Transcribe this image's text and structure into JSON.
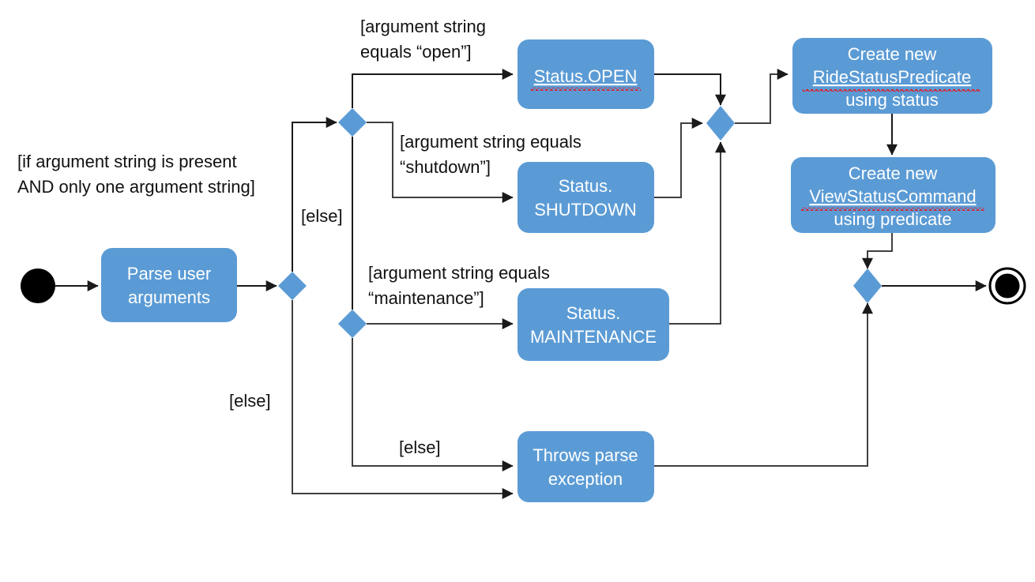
{
  "diagram": {
    "title": "Parse user arguments activity diagram",
    "colors": {
      "activity_fill": "#5B9BD5",
      "edge": "#404040",
      "text_on_node": "#FFFFFF",
      "guard_text": "#111111",
      "spellcheck_underline": "#FF0000",
      "terminal": "#000000",
      "background": "#FFFFFF"
    },
    "nodes": {
      "start": {
        "type": "initial-node",
        "label": ""
      },
      "parse": {
        "type": "activity",
        "label": "Parse user arguments",
        "line1": "Parse user",
        "line2": "arguments"
      },
      "status_open": {
        "type": "activity",
        "label": "Status.OPEN",
        "line1": "Status.OPEN",
        "line2": "",
        "misspelled": true
      },
      "status_shutdown": {
        "type": "activity",
        "label": "Status.SHUTDOWN",
        "line1": "Status.",
        "line2": "SHUTDOWN"
      },
      "status_maintenance": {
        "type": "activity",
        "label": "Status.MAINTENANCE",
        "line1": "Status.",
        "line2": "MAINTENANCE"
      },
      "create_predicate": {
        "type": "activity",
        "label": "Create new RideStatusPredicate using status",
        "line1": "Create new",
        "line2": "RideStatusPredicate",
        "line3": "using status",
        "misspelled": true
      },
      "create_command": {
        "type": "activity",
        "label": "Create new ViewStatusCommand using predicate",
        "line1": "Create new",
        "line2": "ViewStatusCommand",
        "line3": "using predicate",
        "misspelled": true
      },
      "throws_exception": {
        "type": "activity",
        "label": "Throws parse exception",
        "line1": "Throws parse",
        "line2": "exception"
      },
      "decision_main": {
        "type": "decision",
        "label": ""
      },
      "decision_open": {
        "type": "decision",
        "label": ""
      },
      "decision_maintenance": {
        "type": "decision",
        "label": ""
      },
      "merge_status": {
        "type": "merge",
        "label": ""
      },
      "merge_final": {
        "type": "merge",
        "label": ""
      },
      "end": {
        "type": "final-node",
        "label": ""
      }
    },
    "guards": {
      "main_condition": {
        "line1": "[if argument string is present",
        "line2": "AND only one argument string]"
      },
      "open": {
        "line1": "[argument string",
        "line2": "equals “open”]"
      },
      "shutdown": {
        "line1": "[argument string equals",
        "line2": "“shutdown”]"
      },
      "maintenance": {
        "line1": "[argument string equals",
        "line2": "“maintenance”]"
      },
      "else_main": "[else]",
      "else_open": "[else]",
      "else_maintenance": "[else]"
    }
  }
}
